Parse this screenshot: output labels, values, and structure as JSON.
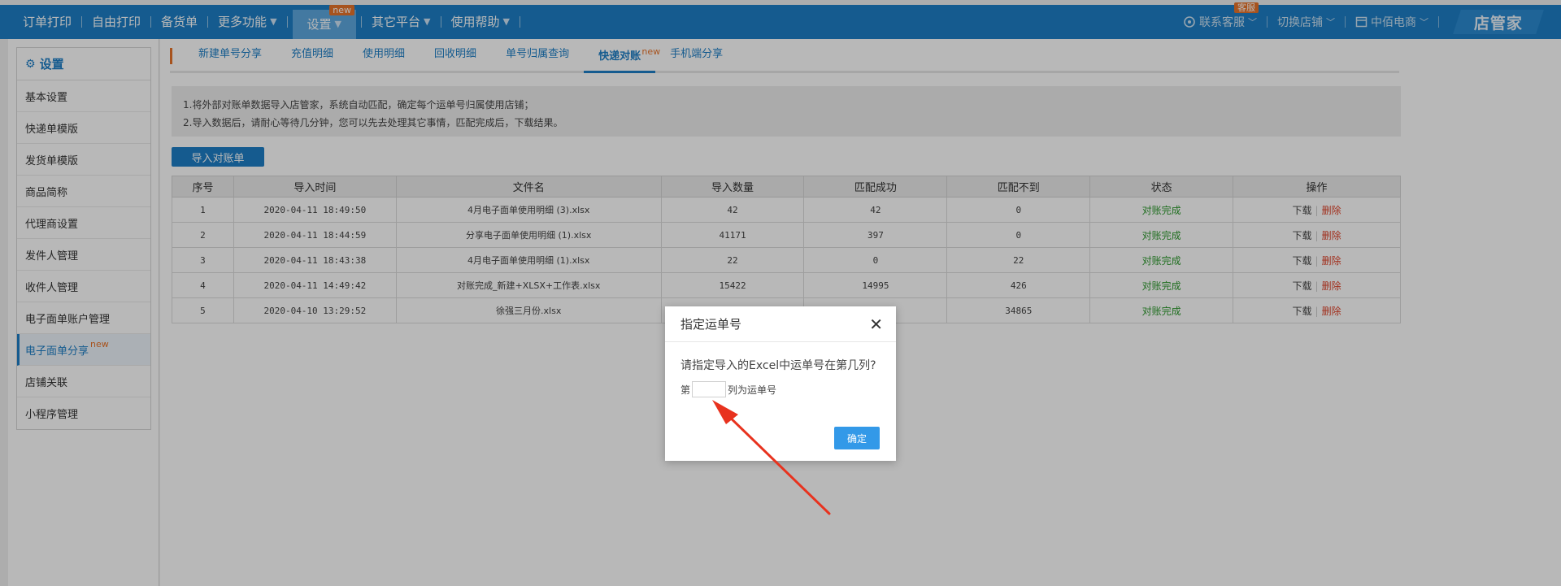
{
  "nav": {
    "items": [
      "订单打印",
      "自由打印",
      "备货单",
      "更多功能",
      "设置",
      "其它平台",
      "使用帮助"
    ],
    "settings_badge": "new",
    "right": {
      "service": "联系客服",
      "service_badge": "客服",
      "switch_store": "切换店铺",
      "company": "中佰电商",
      "brand": "店管家"
    }
  },
  "sidebar": {
    "title": "设置",
    "items": [
      "基本设置",
      "快递单模版",
      "发货单模版",
      "商品简称",
      "代理商设置",
      "发件人管理",
      "收件人管理",
      "电子面单账户管理",
      "电子面单分享",
      "店铺关联",
      "小程序管理"
    ],
    "new_tag": "new"
  },
  "tabs": {
    "items": [
      "新建单号分享",
      "充值明细",
      "使用明细",
      "回收明细",
      "单号归属查询",
      "快递对账",
      "手机端分享"
    ],
    "new_tag": "new"
  },
  "notice": {
    "line1": "1.将外部对账单数据导入店管家，系统自动匹配，确定每个运单号归属使用店铺；",
    "line2": "2.导入数据后，请耐心等待几分钟，您可以先去处理其它事情，匹配完成后，下载结果。"
  },
  "import_button": "导入对账单",
  "table": {
    "headers": [
      "序号",
      "导入时间",
      "文件名",
      "导入数量",
      "匹配成功",
      "匹配不到",
      "状态",
      "操作"
    ],
    "rows": [
      {
        "no": "1",
        "time": "2020-04-11 18:49:50",
        "file": "4月电子面单使用明细 (3).xlsx",
        "count": "42",
        "ok": "42",
        "miss": "0",
        "status": "对账完成",
        "download": "下载",
        "delete": "删除"
      },
      {
        "no": "2",
        "time": "2020-04-11 18:44:59",
        "file": "分享电子面单使用明细 (1).xlsx",
        "count": "41171",
        "ok": "397",
        "miss": "0",
        "status": "对账完成",
        "download": "下载",
        "delete": "删除"
      },
      {
        "no": "3",
        "time": "2020-04-11 18:43:38",
        "file": "4月电子面单使用明细 (1).xlsx",
        "count": "22",
        "ok": "0",
        "miss": "22",
        "status": "对账完成",
        "download": "下载",
        "delete": "删除"
      },
      {
        "no": "4",
        "time": "2020-04-11 14:49:42",
        "file": "对账完成_新建+XLSX+工作表.xlsx",
        "count": "15422",
        "ok": "14995",
        "miss": "426",
        "status": "对账完成",
        "download": "下载",
        "delete": "删除"
      },
      {
        "no": "5",
        "time": "2020-04-10 13:29:52",
        "file": "徐强三月份.xlsx",
        "count": "",
        "ok": "",
        "miss": "34865",
        "status": "对账完成",
        "download": "下载",
        "delete": "删除"
      }
    ]
  },
  "modal": {
    "title": "指定运单号",
    "question": "请指定导入的Excel中运单号在第几列?",
    "prefix": "第",
    "suffix": "列为运单号",
    "column_value": "",
    "ok": "确定"
  },
  "colors": {
    "primary": "#1e7fc6",
    "accent": "#e8732a",
    "success": "#2e9a2e",
    "danger": "#e0442c",
    "arrow": "#e8321e"
  }
}
